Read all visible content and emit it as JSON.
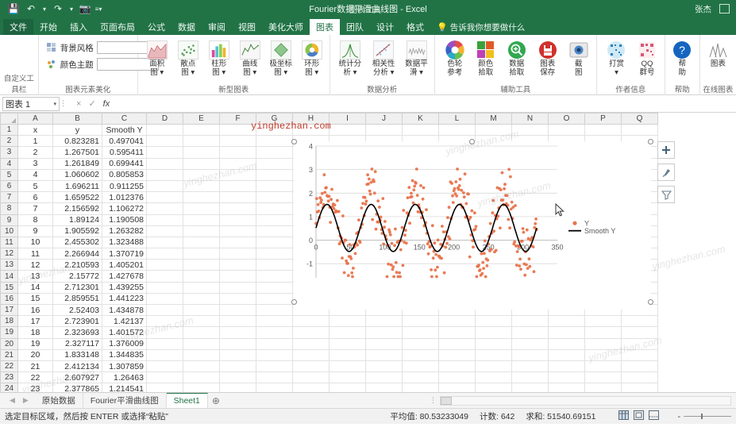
{
  "titlebar": {
    "app_title": "Fourier数据平滑曲线图 - Excel",
    "context_label": "图表工具",
    "user_name": "张杰",
    "qat": [
      {
        "name": "save-icon",
        "glyph": "💾"
      },
      {
        "name": "undo-icon",
        "glyph": "↶"
      },
      {
        "name": "undo-dropdown-icon",
        "glyph": "▾"
      },
      {
        "name": "redo-icon",
        "glyph": "↷"
      },
      {
        "name": "redo-dropdown-icon",
        "glyph": "▾"
      },
      {
        "name": "camera-icon",
        "glyph": "📷"
      },
      {
        "name": "customize-qat-icon",
        "glyph": "≡▾"
      }
    ]
  },
  "tabs": [
    {
      "label": "文件",
      "active": false,
      "file": true
    },
    {
      "label": "开始",
      "active": false
    },
    {
      "label": "插入",
      "active": false
    },
    {
      "label": "页面布局",
      "active": false
    },
    {
      "label": "公式",
      "active": false
    },
    {
      "label": "数据",
      "active": false
    },
    {
      "label": "审阅",
      "active": false
    },
    {
      "label": "视图",
      "active": false
    },
    {
      "label": "美化大师",
      "active": false
    },
    {
      "label": "图表",
      "active": true
    },
    {
      "label": "团队",
      "active": false
    },
    {
      "label": "设计",
      "active": false
    },
    {
      "label": "格式",
      "active": false
    }
  ],
  "tellme": {
    "label": "告诉我你想要做什么",
    "icon": "lightbulb-icon"
  },
  "ribbon": {
    "groups": [
      {
        "label": "自定义工具栏",
        "type": "empty",
        "items": []
      },
      {
        "label": "图表元素美化",
        "type": "controls",
        "controls": [
          {
            "label": "背景风格",
            "icon": "background-style-icon",
            "value": ""
          },
          {
            "label": "颜色主题",
            "icon": "color-theme-icon",
            "value": ""
          }
        ]
      },
      {
        "label": "新型图表",
        "type": "buttons",
        "items": [
          {
            "label": [
              "面积",
              "图 ▾"
            ],
            "icon": "area-chart-icon"
          },
          {
            "label": [
              "散点",
              "图 ▾"
            ],
            "icon": "scatter-chart-icon"
          },
          {
            "label": [
              "柱形",
              "图 ▾"
            ],
            "icon": "column-chart-icon"
          },
          {
            "label": [
              "曲线",
              "图 ▾"
            ],
            "icon": "curve-chart-icon"
          },
          {
            "label": [
              "极坐标",
              "图 ▾"
            ],
            "icon": "polar-chart-icon"
          },
          {
            "label": [
              "环形",
              "图 ▾"
            ],
            "icon": "doughnut-chart-icon"
          }
        ]
      },
      {
        "label": "数据分析",
        "type": "buttons",
        "items": [
          {
            "label": [
              "统计分",
              "析 ▾"
            ],
            "icon": "statistics-icon"
          },
          {
            "label": [
              "相关性",
              "分析 ▾"
            ],
            "icon": "correlation-icon"
          },
          {
            "label": [
              "数据平",
              "滑 ▾"
            ],
            "icon": "smoothing-icon"
          }
        ]
      },
      {
        "label": "辅助工具",
        "type": "buttons",
        "items": [
          {
            "label": [
              "色轮",
              "参考"
            ],
            "icon": "color-wheel-icon"
          },
          {
            "label": [
              "颜色",
              "拾取"
            ],
            "icon": "color-picker-icon"
          },
          {
            "label": [
              "数据",
              "拾取"
            ],
            "icon": "data-picker-icon"
          },
          {
            "label": [
              "图表",
              "保存"
            ],
            "icon": "chart-save-icon"
          },
          {
            "label": [
              "截",
              "图"
            ],
            "icon": "screenshot-icon"
          }
        ]
      },
      {
        "label": "作者信息",
        "type": "buttons",
        "items": [
          {
            "label": [
              "打赏",
              "▾"
            ],
            "icon": "donate-qr-icon"
          },
          {
            "label": [
              "QQ",
              "群号"
            ],
            "icon": "qq-group-icon"
          }
        ]
      },
      {
        "label": "帮助",
        "type": "buttons",
        "items": [
          {
            "label": [
              "帮",
              "助"
            ],
            "icon": "help-icon"
          }
        ]
      },
      {
        "label": "在线图表",
        "type": "buttons",
        "items": [
          {
            "label": [
              "图表",
              ""
            ],
            "icon": "online-chart-icon"
          }
        ]
      }
    ]
  },
  "formula_bar": {
    "name_box": "图表 1",
    "cancel_icon": "×",
    "confirm_icon": "✓",
    "fx_label": "fx",
    "formula_value": ""
  },
  "grid": {
    "columns": [
      "A",
      "B",
      "C",
      "D",
      "E",
      "F",
      "G",
      "H",
      "I",
      "J",
      "K",
      "L",
      "M",
      "N",
      "O",
      "P",
      "Q"
    ],
    "rows": [
      {
        "n": "1",
        "a": "x",
        "b": "y",
        "c": "Smooth Y"
      },
      {
        "n": "2",
        "a": "1",
        "b": "0.823281",
        "c": "0.497041"
      },
      {
        "n": "3",
        "a": "2",
        "b": "1.267501",
        "c": "0.595411"
      },
      {
        "n": "4",
        "a": "3",
        "b": "1.261849",
        "c": "0.699441"
      },
      {
        "n": "5",
        "a": "4",
        "b": "1.060602",
        "c": "0.805853"
      },
      {
        "n": "6",
        "a": "5",
        "b": "1.696211",
        "c": "0.911255"
      },
      {
        "n": "7",
        "a": "6",
        "b": "1.659522",
        "c": "1.012376"
      },
      {
        "n": "8",
        "a": "7",
        "b": "2.156592",
        "c": "1.106272"
      },
      {
        "n": "9",
        "a": "8",
        "b": "1.89124",
        "c": "1.190508"
      },
      {
        "n": "10",
        "a": "9",
        "b": "1.905592",
        "c": "1.263282"
      },
      {
        "n": "11",
        "a": "10",
        "b": "2.455302",
        "c": "1.323488"
      },
      {
        "n": "12",
        "a": "11",
        "b": "2.266944",
        "c": "1.370719"
      },
      {
        "n": "13",
        "a": "12",
        "b": "2.210593",
        "c": "1.405201"
      },
      {
        "n": "14",
        "a": "13",
        "b": "2.15772",
        "c": "1.427678"
      },
      {
        "n": "15",
        "a": "14",
        "b": "2.712301",
        "c": "1.439255"
      },
      {
        "n": "16",
        "a": "15",
        "b": "2.859551",
        "c": "1.441223"
      },
      {
        "n": "17",
        "a": "16",
        "b": "2.52403",
        "c": "1.434878"
      },
      {
        "n": "18",
        "a": "17",
        "b": "2.723901",
        "c": "1.42137"
      },
      {
        "n": "19",
        "a": "18",
        "b": "2.323693",
        "c": "1.401572"
      },
      {
        "n": "20",
        "a": "19",
        "b": "2.327117",
        "c": "1.376009"
      },
      {
        "n": "21",
        "a": "20",
        "b": "1.833148",
        "c": "1.344835"
      },
      {
        "n": "22",
        "a": "21",
        "b": "2.412134",
        "c": "1.307859"
      },
      {
        "n": "23",
        "a": "22",
        "b": "2.607927",
        "c": "1.26463"
      },
      {
        "n": "24",
        "a": "23",
        "b": "2.377865",
        "c": "1.214541"
      }
    ]
  },
  "chart_data": {
    "type": "scatter",
    "title": "",
    "xlabel": "",
    "ylabel": "",
    "xlim": [
      0,
      350
    ],
    "ylim": [
      -1.6,
      4
    ],
    "xticks": [
      0,
      50,
      100,
      150,
      200,
      250,
      300,
      350
    ],
    "yticks": [
      -1,
      0,
      1,
      2,
      3,
      4
    ],
    "grid": "horizontal",
    "legend_position": "right",
    "series": [
      {
        "name": "Y",
        "type": "scatter",
        "color": "#E8744D",
        "marker": "circle",
        "description": "噪声数据点，按正弦周期约64单位聚集，纵向散布在 -1.6 到 3.0 之间",
        "sin_amplitude": 1.45,
        "sin_period": 64,
        "sin_offset": 0.6,
        "noise_spread": 1.0,
        "n_points": 321
      },
      {
        "name": "Smooth Y",
        "type": "line",
        "color": "#000000",
        "description": "Fourier 平滑后的正弦曲线，5个完整周期",
        "sin_amplitude": 1.0,
        "sin_period": 64,
        "sin_offset": 0.52,
        "x_start": 0,
        "x_end": 320
      }
    ]
  },
  "chart_side_buttons": [
    {
      "name": "chart-elements-button",
      "glyph": "＋"
    },
    {
      "name": "chart-styles-button",
      "glyph": "🖌"
    },
    {
      "name": "chart-filters-button",
      "glyph": "▽"
    }
  ],
  "sheet_tabs": {
    "nav_prev": "◀",
    "nav_next": "▶",
    "tabs": [
      {
        "label": "原始数据",
        "active": false
      },
      {
        "label": "Fourier平滑曲线图",
        "active": false
      },
      {
        "label": "Sheet1",
        "active": true
      }
    ],
    "add_label": "⊕"
  },
  "status_bar": {
    "message": "选定目标区域，然后按 ENTER 或选择“粘贴”",
    "average": "平均值: 80.53233049",
    "count": "计数: 642",
    "sum": "求和: 51540.69151",
    "view_buttons": [
      "normal-view-icon",
      "page-layout-view-icon",
      "page-break-view-icon"
    ],
    "zoom_minus": "-",
    "zoom_plus": ""
  },
  "watermarks": {
    "red_text": "yinghezhan.com",
    "gray_text": "yinghezhan.com"
  }
}
